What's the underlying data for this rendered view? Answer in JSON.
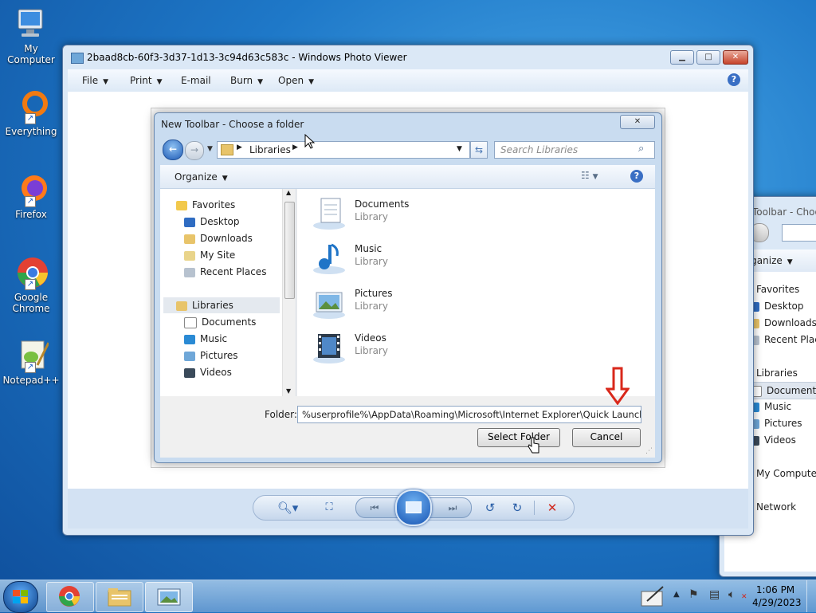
{
  "desktop": {
    "icons": [
      {
        "label": "My Computer"
      },
      {
        "label": "Everything"
      },
      {
        "label": "Firefox"
      },
      {
        "label": "Google Chrome"
      },
      {
        "label": "Notepad++"
      }
    ]
  },
  "photo_viewer": {
    "title": "2baad8cb-60f3-3d37-1d13-3c94d63c583c - Windows Photo Viewer",
    "menu": [
      "File",
      "Print",
      "E-mail",
      "Burn",
      "Open"
    ]
  },
  "dialog": {
    "title": "New Toolbar - Choose a folder",
    "breadcrumb": "Libraries",
    "search_placeholder": "Search Libraries",
    "organize_label": "Organize",
    "nav": {
      "favorites_label": "Favorites",
      "favorites": [
        "Desktop",
        "Downloads",
        "My Site",
        "Recent Places"
      ],
      "libraries_label": "Libraries",
      "libraries": [
        "Documents",
        "Music",
        "Pictures",
        "Videos"
      ]
    },
    "items": [
      {
        "name": "Documents",
        "type": "Library"
      },
      {
        "name": "Music",
        "type": "Library"
      },
      {
        "name": "Pictures",
        "type": "Library"
      },
      {
        "name": "Videos",
        "type": "Library"
      }
    ],
    "folder_label": "Folder:",
    "folder_value": "%userprofile%\\AppData\\Roaming\\Microsoft\\Internet Explorer\\Quick Launch",
    "select_button": "Select Folder",
    "cancel_button": "Cancel"
  },
  "background_dialog": {
    "title": "New Toolbar - Choos",
    "organize_label": "Organize",
    "favorites_label": "Favorites",
    "favorites": [
      "Desktop",
      "Downloads",
      "Recent Place"
    ],
    "libraries_label": "Libraries",
    "libraries": [
      "Documents",
      "Music",
      "Pictures",
      "Videos"
    ],
    "computer_label": "My Computer",
    "network_label": "Network"
  },
  "taskbar": {
    "time": "1:06 PM",
    "date": "4/29/2023"
  },
  "colors": {
    "accent": "#1e78c8",
    "close": "#c7452c",
    "annotation_arrow": "#d9281b"
  }
}
